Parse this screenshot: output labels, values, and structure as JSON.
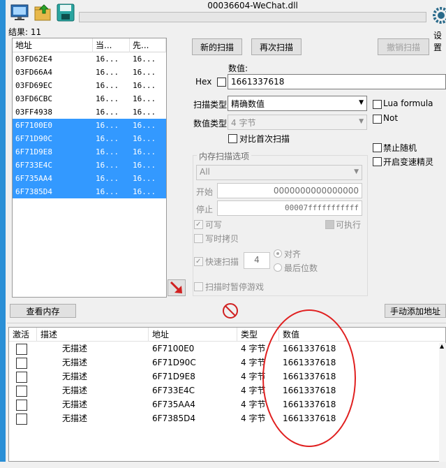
{
  "window": {
    "title": "00036604-WeChat.dll",
    "results": "结果: 11",
    "settings_label": "设置"
  },
  "address_list": {
    "columns": [
      "地址",
      "当...",
      "先..."
    ],
    "rows": [
      {
        "addr": "03FD62E4",
        "cur": "16...",
        "prev": "16...",
        "selected": false
      },
      {
        "addr": "03FD66A4",
        "cur": "16...",
        "prev": "16...",
        "selected": false
      },
      {
        "addr": "03FD69EC",
        "cur": "16...",
        "prev": "16...",
        "selected": false
      },
      {
        "addr": "03FD6CBC",
        "cur": "16...",
        "prev": "16...",
        "selected": false
      },
      {
        "addr": "03FF4938",
        "cur": "16...",
        "prev": "16...",
        "selected": false
      },
      {
        "addr": "6F7100E0",
        "cur": "16...",
        "prev": "16...",
        "selected": true
      },
      {
        "addr": "6F71D90C",
        "cur": "16...",
        "prev": "16...",
        "selected": true
      },
      {
        "addr": "6F71D9E8",
        "cur": "16...",
        "prev": "16...",
        "selected": true
      },
      {
        "addr": "6F733E4C",
        "cur": "16...",
        "prev": "16...",
        "selected": true
      },
      {
        "addr": "6F735AA4",
        "cur": "16...",
        "prev": "16...",
        "selected": true
      },
      {
        "addr": "6F7385D4",
        "cur": "16...",
        "prev": "16...",
        "selected": true
      }
    ]
  },
  "scan": {
    "new_scan": "新的扫描",
    "next_scan": "再次扫描",
    "undo_scan": "撤销扫描",
    "value_label": "数值:",
    "hex_label": "Hex",
    "value": "1661337618",
    "scan_type_label": "扫描类型",
    "scan_type": "精确数值",
    "value_type_label": "数值类型",
    "value_type": "4 字节",
    "compare_first": "对比首次扫描",
    "lua_formula": "Lua formula",
    "not_label": "Not",
    "disable_random": "禁止随机",
    "speedhack": "开启变速精灵"
  },
  "memory_options": {
    "title": "内存扫描选项",
    "region": "All",
    "start_label": "开始",
    "start_value": "0000000000000000",
    "stop_label": "停止",
    "stop_value": "00007fffffffffff",
    "writable": "可写",
    "executable": "可执行",
    "copy_on_write": "写时拷贝",
    "fast_scan": "快速扫描",
    "fast_scan_value": "4",
    "align": "对齐",
    "last_digits": "最后位数",
    "pause_game": "扫描时暂停游戏"
  },
  "actions": {
    "view_memory": "查看内存",
    "add_address": "手动添加地址"
  },
  "cheat_table": {
    "columns": [
      "激活",
      "描述",
      "地址",
      "类型",
      "数值"
    ],
    "rows": [
      {
        "desc": "无描述",
        "addr": "6F7100E0",
        "type": "4 字节",
        "value": "1661337618"
      },
      {
        "desc": "无描述",
        "addr": "6F71D90C",
        "type": "4 字节",
        "value": "1661337618"
      },
      {
        "desc": "无描述",
        "addr": "6F71D9E8",
        "type": "4 字节",
        "value": "1661337618"
      },
      {
        "desc": "无描述",
        "addr": "6F733E4C",
        "type": "4 字节",
        "value": "1661337618"
      },
      {
        "desc": "无描述",
        "addr": "6F735AA4",
        "type": "4 字节",
        "value": "1661337618"
      },
      {
        "desc": "无描述",
        "addr": "6F7385D4",
        "type": "4 字节",
        "value": "1661337618"
      }
    ]
  },
  "icons": {
    "toolbar": [
      "computer-icon",
      "open-folder-icon",
      "save-icon"
    ],
    "settings": "gear-icon",
    "arrow": "red-arrow-icon",
    "clear": "no-entry-icon"
  },
  "colors": {
    "selection": "#3399ff",
    "highlight_circle": "#e02020"
  }
}
